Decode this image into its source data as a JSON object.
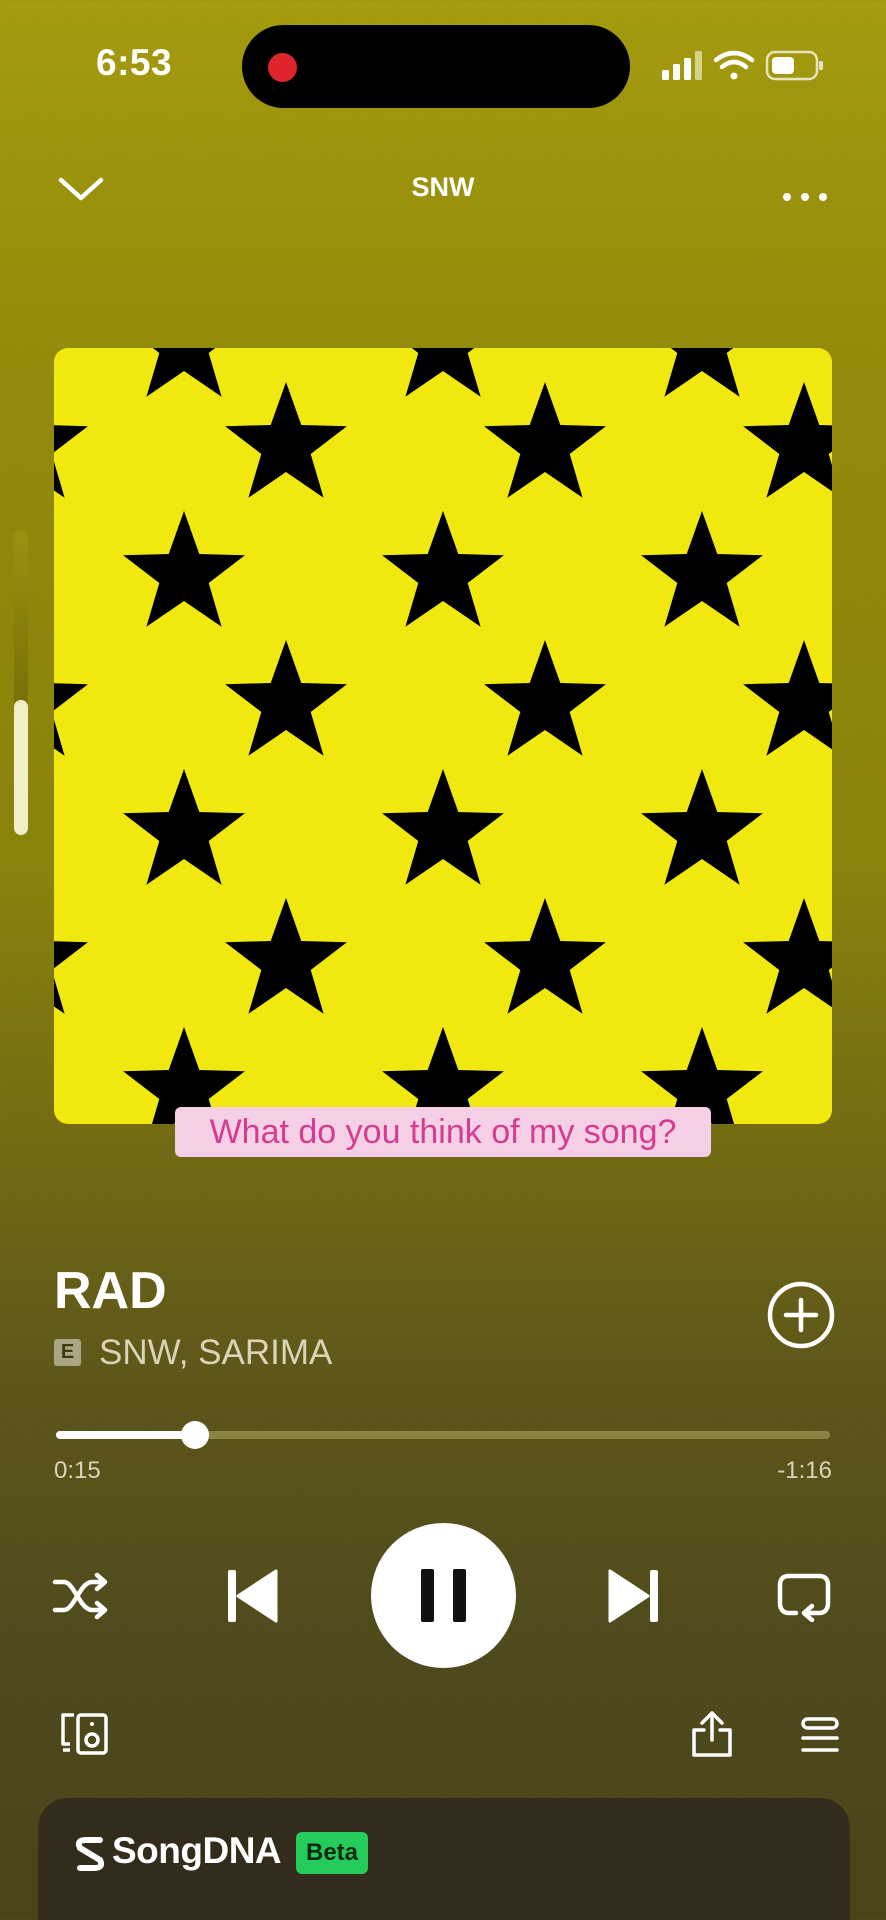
{
  "status_bar": {
    "time": "6:53",
    "icons": [
      "signal-icon",
      "wifi-icon",
      "battery-icon"
    ]
  },
  "header": {
    "title": "SNW",
    "left_icon": "chevron-down-icon",
    "right_icon": "more-icon"
  },
  "album_art": {
    "background": "#f1e80f",
    "pattern_color": "#000000",
    "pattern": "star-pattern"
  },
  "caption": {
    "text": "What do you think of my song?"
  },
  "track": {
    "title": "RAD",
    "explicit_badge": "E",
    "artists": "SNW, SARIMA"
  },
  "progress": {
    "elapsed": "0:15",
    "remaining": "-1:16",
    "fraction": 0.18
  },
  "controls": {
    "shuffle": "shuffle-icon",
    "previous": "skip-back-icon",
    "play_pause": "pause-icon",
    "next": "skip-forward-icon",
    "repeat": "repeat-icon"
  },
  "bottom_actions": {
    "devices": "connect-device-icon",
    "share": "share-icon",
    "queue": "queue-icon"
  },
  "songdna": {
    "title": "SongDNA",
    "badge": "Beta",
    "badge_color": "#24cc5b"
  },
  "colors": {
    "accent_caption_text": "#d43c8f",
    "caption_bg": "#f5cfe6",
    "panel_bg": "#332b1c"
  }
}
